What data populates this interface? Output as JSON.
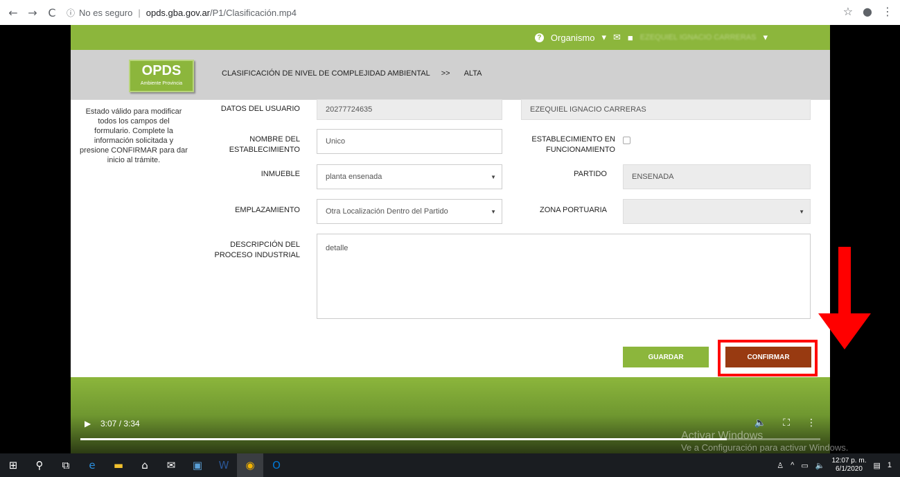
{
  "browser": {
    "back_icon": "←",
    "forward_icon": "→",
    "reload_icon": "C",
    "security_text": "No es seguro",
    "url_host": "opds.gba.gov.ar",
    "url_path": "/P1/Clasificación.mp4",
    "star_icon": "☆",
    "account_icon": "●",
    "menu_icon": "⋮"
  },
  "site": {
    "topbar": {
      "organismo_label": "Organismo",
      "user_name_blurred": "EZEQUIEL IGNACIO CARRERAS"
    },
    "logo": {
      "title": "OPDS",
      "subtitle": "Ambiente Provincia"
    },
    "breadcrumb": {
      "section": "CLASIFICACIÓN DE NIVEL DE COMPLEJIDAD AMBIENTAL",
      "separator": ">>",
      "current": "ALTA"
    },
    "help_text": "Estado válido para modificar todos los campos del formulario. Complete la información solicitada y presione CONFIRMAR para dar inicio al trámite.",
    "form": {
      "datos_usuario_label": "DATOS DEL USUARIO",
      "cuit_value": "20277724635",
      "user_full_name": "EZEQUIEL IGNACIO CARRERAS",
      "nombre_label": "NOMBRE DEL ESTABLECIMIENTO",
      "nombre_value": "Unico",
      "funcionamiento_label": "ESTABLECIMIENTO EN FUNCIONAMIENTO",
      "inmueble_label": "INMUEBLE",
      "inmueble_value": "planta ensenada",
      "partido_label": "PARTIDO",
      "partido_value": "ENSENADA",
      "emplazamiento_label": "EMPLAZAMIENTO",
      "emplazamiento_value": "Otra Localización Dentro del Partido",
      "zona_label": "ZONA PORTUARIA",
      "zona_value": "",
      "descripcion_label": "DESCRIPCIÓN DEL PROCESO INDUSTRIAL",
      "descripcion_value": "detalle",
      "save_label": "GUARDAR",
      "confirm_label": "CONFIRMAR"
    }
  },
  "video": {
    "time": "3:07 / 3:34",
    "progress": 0.874,
    "watermark_title": "Activar Windows",
    "watermark_sub": "Ve a Configuración para activar Windows."
  },
  "taskbar": {
    "time": "12:07 p. m.",
    "date": "6/1/2020",
    "notification_count": "1"
  }
}
